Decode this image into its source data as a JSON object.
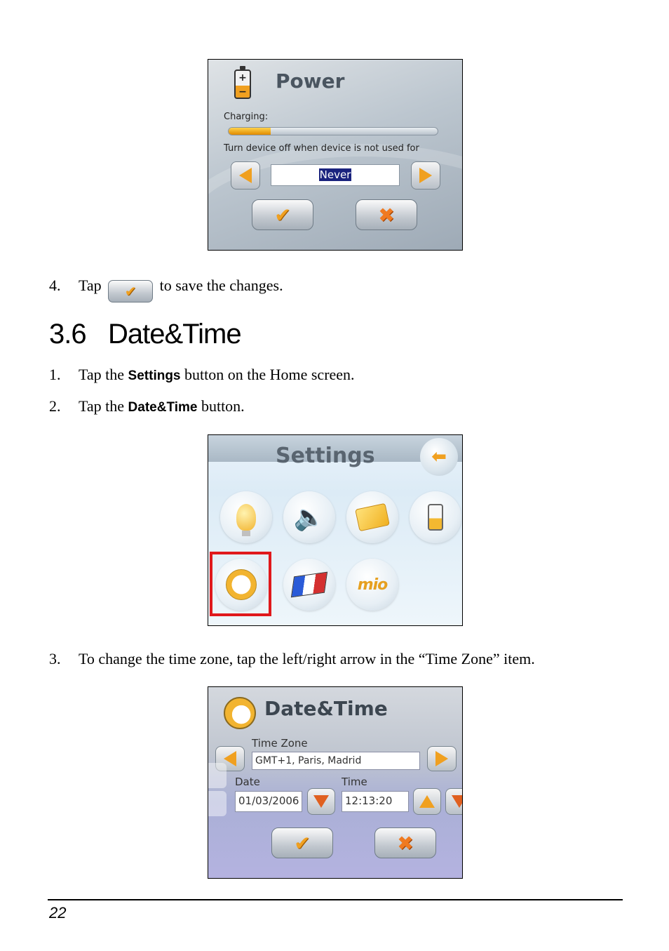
{
  "power_screen": {
    "title": "Power",
    "charging_label": "Charging:",
    "charge_level": 0.2,
    "auto_off_label": "Turn device off when device is not used for",
    "auto_off_value": "Never",
    "ok_symbol": "✔",
    "cancel_symbol": "✖"
  },
  "steps_a": [
    {
      "num": "4.",
      "before": "Tap",
      "after": "to save the changes."
    }
  ],
  "section": {
    "number": "3.6",
    "title": "Date&Time"
  },
  "steps_b": [
    {
      "num": "1.",
      "before": "Tap the",
      "ui": "Settings",
      "after": "button on the Home screen."
    },
    {
      "num": "2.",
      "before": "Tap the",
      "ui": "Date&Time",
      "after": "button."
    }
  ],
  "settings_screen": {
    "title": "Settings",
    "back_symbol": "⬅",
    "speaker_symbol": "🔈",
    "mio_text": "mio"
  },
  "steps_c": [
    {
      "num": "3.",
      "text": "To change the time zone, tap the left/right arrow in the “Time Zone” item."
    }
  ],
  "datetime_screen": {
    "title": "Date&Time",
    "timezone_label": "Time Zone",
    "timezone_value": "GMT+1, Paris, Madrid",
    "date_label": "Date",
    "date_value": "01/03/2006",
    "time_label": "Time",
    "time_value": "12:13:20"
  },
  "footer": {
    "page_number": "22"
  },
  "colors": {
    "highlight": "#e0191c",
    "accent": "#f0a020"
  }
}
